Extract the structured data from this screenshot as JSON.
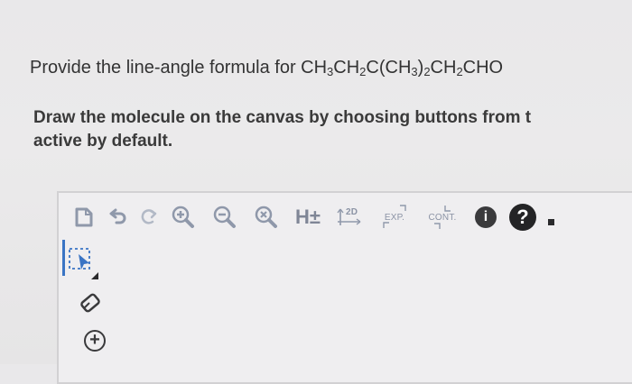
{
  "question": {
    "prefix": "Provide the line-angle formula for ",
    "formula_parts": [
      "CH",
      "3",
      "CH",
      "2",
      "C(CH",
      "3",
      ")",
      "2",
      "CH",
      "2",
      "CHO"
    ]
  },
  "instruction": {
    "line1": "Draw the molecule on the canvas by choosing buttons from t",
    "line2": "active by default."
  },
  "toolbar": {
    "h_label": "H±",
    "dim_label": "2D",
    "exp_label": "EXP.",
    "cont_label": "CONT.",
    "info_label": "i",
    "help_label": "?"
  },
  "sidetools": {
    "add_label": "+"
  },
  "colors": {
    "icon_gray": "#9aa3b3",
    "badge_dark": "#2a2a2c",
    "select_blue": "#3a74c4"
  }
}
